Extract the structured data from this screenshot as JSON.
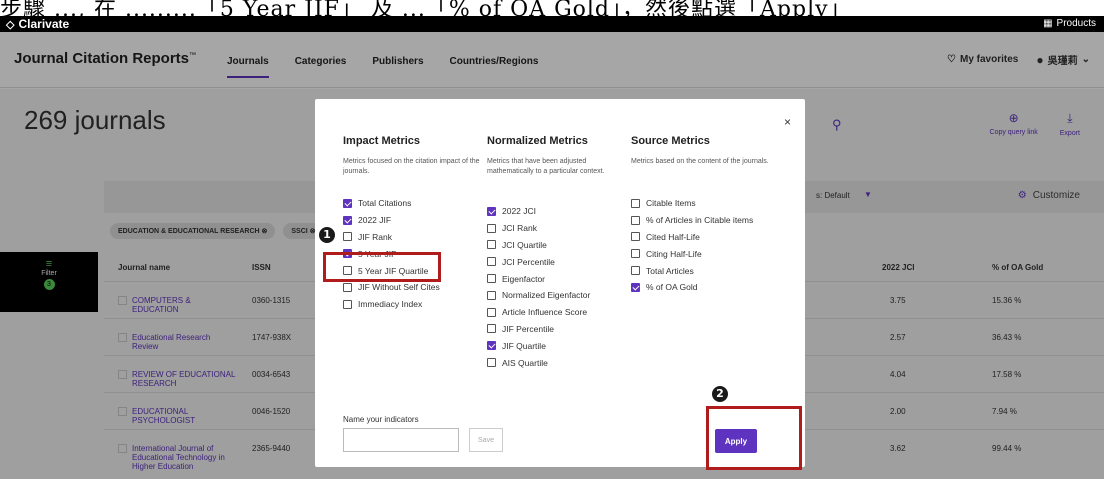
{
  "caption": {
    "text": "步驟 ..., 在 .........「5 Year JIF」 及  ...「% of OA Gold」，然後點選「Apply」"
  },
  "brandbar": {
    "brand": "Clarivate",
    "products": "Products"
  },
  "nav": {
    "title": "Journal Citation Reports",
    "title_mark": "™",
    "tabs": [
      "Journals",
      "Categories",
      "Publishers",
      "Countries/Regions"
    ],
    "favorites": "My favorites",
    "user": "吳瑾莉"
  },
  "page": {
    "journal_count": "269 journals",
    "copy_query": "Copy query link",
    "export": "Export",
    "sort_label": "s: Default",
    "customize": "Customize",
    "chips": [
      "EDUCATION & EDUCATIONAL RESEARCH",
      "SSCI"
    ],
    "filter_label": "Filter",
    "filter_count": "3"
  },
  "table": {
    "headers": {
      "name": "Journal name",
      "issn": "ISSN",
      "jci": "2022 JCI",
      "oa": "% of OA Gold"
    },
    "rows": [
      {
        "name": "COMPUTERS & EDUCATION",
        "issn": "0360-1315",
        "jci": "3.75",
        "oa": "15.36 %"
      },
      {
        "name": "Educational Research Review",
        "issn": "1747-938X",
        "jci": "2.57",
        "oa": "36.43 %"
      },
      {
        "name": "REVIEW OF EDUCATIONAL RESEARCH",
        "issn": "0034-6543",
        "jci": "4.04",
        "oa": "17.58 %"
      },
      {
        "name": "EDUCATIONAL PSYCHOLOGIST",
        "issn": "0046-1520",
        "jci": "2.00",
        "oa": "7.94 %"
      },
      {
        "name": "International Journal of Educational Technology in Higher Education",
        "issn": "2365-9440",
        "jci": "3.62",
        "oa": "99.44 %"
      }
    ]
  },
  "modal": {
    "columns": [
      {
        "title": "Impact Metrics",
        "desc": "Metrics focused on the citation impact of the journals.",
        "options": [
          {
            "label": "Total Citations",
            "checked": true
          },
          {
            "label": "2022 JIF",
            "checked": true
          },
          {
            "label": "JIF Rank",
            "checked": false
          },
          {
            "label": "5 Year JIF",
            "checked": true
          },
          {
            "label": "5 Year JIF Quartile",
            "checked": false
          },
          {
            "label": "JIF Without Self Cites",
            "checked": false
          },
          {
            "label": "Immediacy Index",
            "checked": false
          }
        ]
      },
      {
        "title": "Normalized Metrics",
        "desc": "Metrics that have been adjusted mathematically to a particular context.",
        "options": [
          {
            "label": "2022 JCI",
            "checked": true
          },
          {
            "label": "JCI Rank",
            "checked": false
          },
          {
            "label": "JCI Quartile",
            "checked": false
          },
          {
            "label": "JCI Percentile",
            "checked": false
          },
          {
            "label": "Eigenfactor",
            "checked": false
          },
          {
            "label": "Normalized Eigenfactor",
            "checked": false
          },
          {
            "label": "Article Influence Score",
            "checked": false
          },
          {
            "label": "JIF Percentile",
            "checked": false
          },
          {
            "label": "JIF Quartile",
            "checked": true
          },
          {
            "label": "AIS Quartile",
            "checked": false
          }
        ]
      },
      {
        "title": "Source Metrics",
        "desc": "Metrics based on the content of the journals.",
        "options": [
          {
            "label": "Citable Items",
            "checked": false
          },
          {
            "label": "% of Articles in Citable items",
            "checked": false
          },
          {
            "label": "Cited Half-Life",
            "checked": false
          },
          {
            "label": "Citing Half-Life",
            "checked": false
          },
          {
            "label": "Total Articles",
            "checked": false
          },
          {
            "label": "% of OA Gold",
            "checked": true
          }
        ]
      }
    ],
    "name_label": "Name your indicators",
    "save": "Save",
    "apply": "Apply",
    "close": "×"
  },
  "annotations": {
    "step1": "1",
    "step2": "2",
    "highlight_color": "#b01c1c"
  },
  "colors": {
    "accent": "#5e33bf",
    "filter_green": "#5bd35b"
  }
}
